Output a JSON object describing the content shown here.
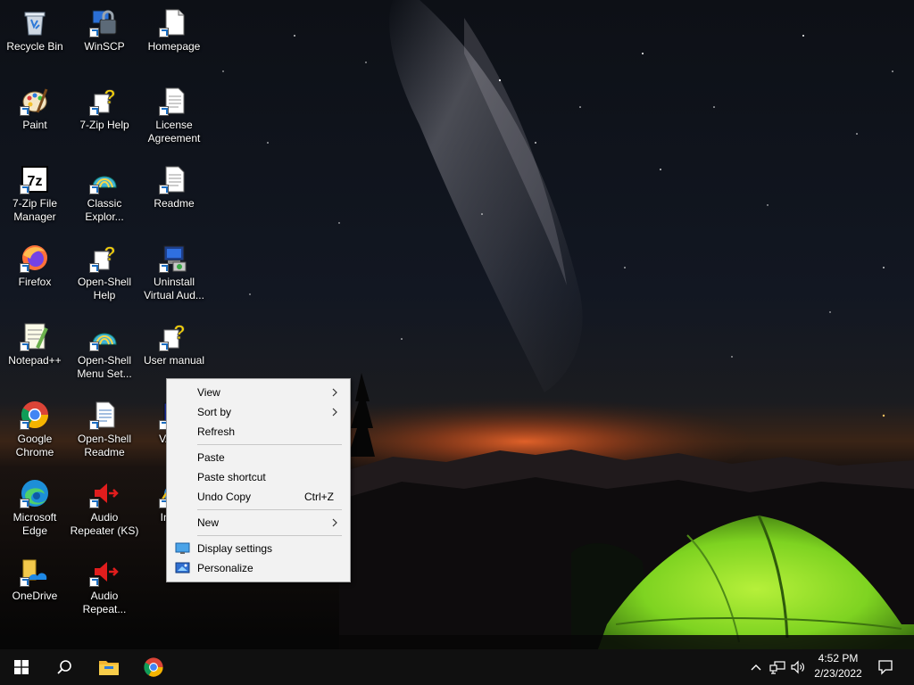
{
  "desktop": {
    "icons": [
      {
        "id": "recycle-bin",
        "label": "Recycle Bin"
      },
      {
        "id": "winscp",
        "label": "WinSCP"
      },
      {
        "id": "homepage",
        "label": "Homepage"
      },
      {
        "id": "paint",
        "label": "Paint"
      },
      {
        "id": "7zip-help",
        "label": "7-Zip Help"
      },
      {
        "id": "license-agreement",
        "label": "License Agreement"
      },
      {
        "id": "7zip-file-manager",
        "label": "7-Zip File Manager"
      },
      {
        "id": "classic-explorer",
        "label": "Classic Explor..."
      },
      {
        "id": "readme",
        "label": "Readme"
      },
      {
        "id": "firefox",
        "label": "Firefox"
      },
      {
        "id": "open-shell-help",
        "label": "Open-Shell Help"
      },
      {
        "id": "uninstall-virtual-audio",
        "label": "Uninstall Virtual Aud..."
      },
      {
        "id": "notepad-plus-plus",
        "label": "Notepad++"
      },
      {
        "id": "open-shell-menu-settings",
        "label": "Open-Shell Menu Set..."
      },
      {
        "id": "user-manual",
        "label": "User manual"
      },
      {
        "id": "google-chrome",
        "label": "Google Chrome"
      },
      {
        "id": "open-shell-readme",
        "label": "Open-Shell Readme"
      },
      {
        "id": "vac",
        "label": "VAC p"
      },
      {
        "id": "microsoft-edge",
        "label": "Microsoft Edge"
      },
      {
        "id": "audio-repeater-ks",
        "label": "Audio Repeater (KS)"
      },
      {
        "id": "internet-explorer",
        "label": "Int Ex"
      },
      {
        "id": "onedrive",
        "label": "OneDrive"
      },
      {
        "id": "audio-repeater",
        "label": "Audio Repeat..."
      }
    ]
  },
  "context_menu": {
    "view": "View",
    "sort_by": "Sort by",
    "refresh": "Refresh",
    "paste": "Paste",
    "paste_shortcut": "Paste shortcut",
    "undo_copy": "Undo Copy",
    "undo_copy_accel": "Ctrl+Z",
    "new": "New",
    "display_settings": "Display settings",
    "personalize": "Personalize"
  },
  "taskbar": {
    "start_icon": "windows-logo-icon",
    "search_icon": "search-icon",
    "pinned": [
      "file-explorer-icon",
      "chrome-icon"
    ],
    "tray_icons": [
      "chevron-up-icon",
      "network-icon",
      "volume-icon"
    ],
    "time": "4:52 PM",
    "date": "2/23/2022",
    "notification_icon": "action-center-icon"
  },
  "colors": {
    "menu_bg": "#f2f2f2",
    "taskbar_bg": "#101010",
    "tent_green": "#7ed321"
  }
}
